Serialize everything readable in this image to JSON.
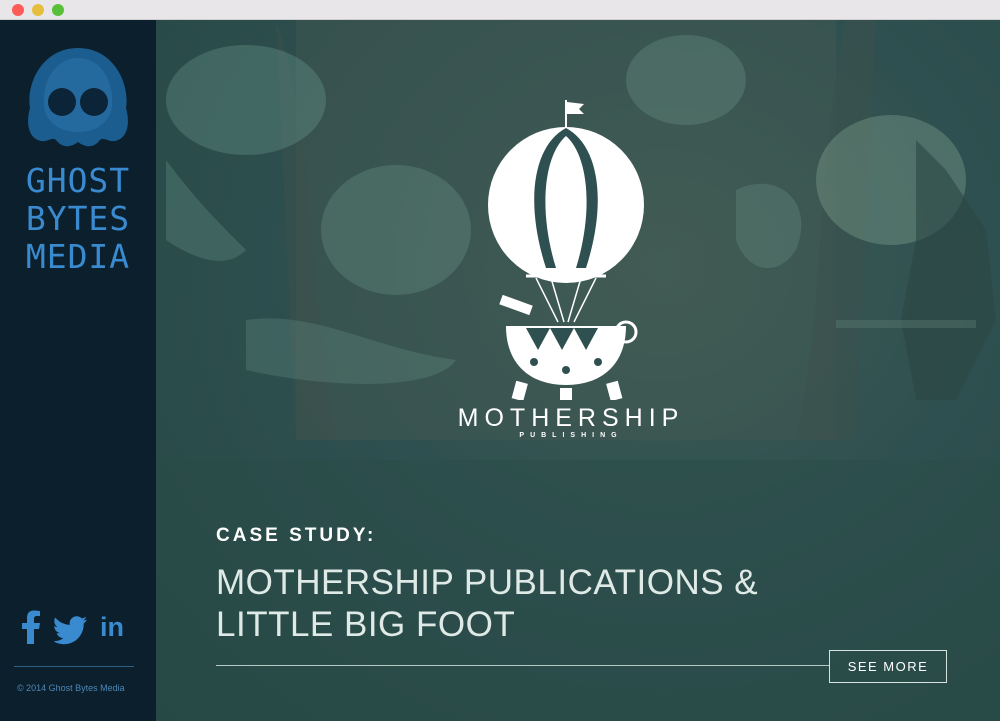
{
  "sidebar": {
    "brand_lines": [
      "GHOST",
      "BYTES",
      "MEDIA"
    ],
    "social": {
      "facebook_icon": "facebook-icon",
      "twitter_icon": "twitter-icon",
      "linkedin_label": "in"
    },
    "copyright": "© 2014 Ghost Bytes Media"
  },
  "hero": {
    "featured_brand": {
      "name": "MOTHERSHIP",
      "subname": "PUBLISHING"
    },
    "case_label": "CASE STUDY:",
    "case_title_lines": [
      "MOTHERSHIP PUBLICATIONS &",
      "LITTLE BIG FOOT"
    ],
    "cta_label": "SEE MORE"
  },
  "colors": {
    "sidebar_bg": "#0c1f2c",
    "brand_blue": "#3a8ad0",
    "hero_bg": "#2f5050",
    "text_white": "#ffffff"
  }
}
